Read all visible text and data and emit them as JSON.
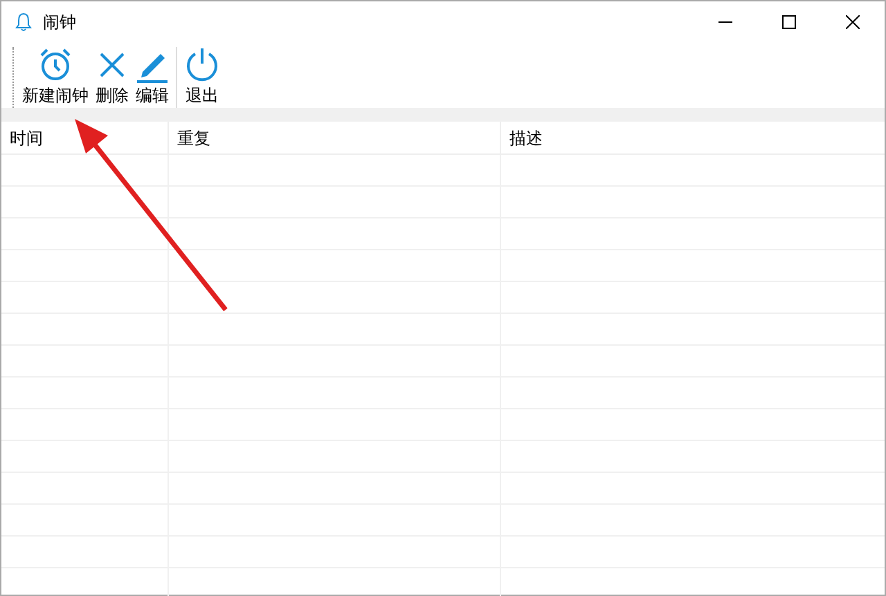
{
  "window": {
    "title": "闹钟"
  },
  "toolbar": [
    {
      "kind": "alarm",
      "label": "新建闹钟"
    },
    {
      "kind": "delete",
      "label": "删除"
    },
    {
      "kind": "edit",
      "label": "编辑"
    },
    {
      "kind": "exit",
      "label": "退出"
    }
  ],
  "table": {
    "columns": [
      "时间",
      "重复",
      "描述"
    ]
  }
}
